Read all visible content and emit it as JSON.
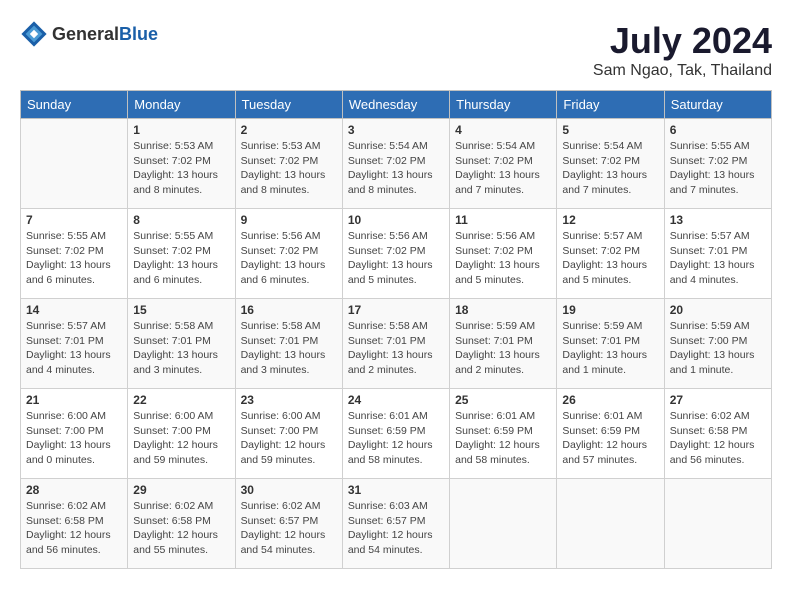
{
  "logo": {
    "text_general": "General",
    "text_blue": "Blue"
  },
  "title": {
    "month": "July 2024",
    "location": "Sam Ngao, Tak, Thailand"
  },
  "weekdays": [
    "Sunday",
    "Monday",
    "Tuesday",
    "Wednesday",
    "Thursday",
    "Friday",
    "Saturday"
  ],
  "weeks": [
    [
      {
        "day": "",
        "sunrise": "",
        "sunset": "",
        "daylight": ""
      },
      {
        "day": "1",
        "sunrise": "Sunrise: 5:53 AM",
        "sunset": "Sunset: 7:02 PM",
        "daylight": "Daylight: 13 hours and 8 minutes."
      },
      {
        "day": "2",
        "sunrise": "Sunrise: 5:53 AM",
        "sunset": "Sunset: 7:02 PM",
        "daylight": "Daylight: 13 hours and 8 minutes."
      },
      {
        "day": "3",
        "sunrise": "Sunrise: 5:54 AM",
        "sunset": "Sunset: 7:02 PM",
        "daylight": "Daylight: 13 hours and 8 minutes."
      },
      {
        "day": "4",
        "sunrise": "Sunrise: 5:54 AM",
        "sunset": "Sunset: 7:02 PM",
        "daylight": "Daylight: 13 hours and 7 minutes."
      },
      {
        "day": "5",
        "sunrise": "Sunrise: 5:54 AM",
        "sunset": "Sunset: 7:02 PM",
        "daylight": "Daylight: 13 hours and 7 minutes."
      },
      {
        "day": "6",
        "sunrise": "Sunrise: 5:55 AM",
        "sunset": "Sunset: 7:02 PM",
        "daylight": "Daylight: 13 hours and 7 minutes."
      }
    ],
    [
      {
        "day": "7",
        "sunrise": "Sunrise: 5:55 AM",
        "sunset": "Sunset: 7:02 PM",
        "daylight": "Daylight: 13 hours and 6 minutes."
      },
      {
        "day": "8",
        "sunrise": "Sunrise: 5:55 AM",
        "sunset": "Sunset: 7:02 PM",
        "daylight": "Daylight: 13 hours and 6 minutes."
      },
      {
        "day": "9",
        "sunrise": "Sunrise: 5:56 AM",
        "sunset": "Sunset: 7:02 PM",
        "daylight": "Daylight: 13 hours and 6 minutes."
      },
      {
        "day": "10",
        "sunrise": "Sunrise: 5:56 AM",
        "sunset": "Sunset: 7:02 PM",
        "daylight": "Daylight: 13 hours and 5 minutes."
      },
      {
        "day": "11",
        "sunrise": "Sunrise: 5:56 AM",
        "sunset": "Sunset: 7:02 PM",
        "daylight": "Daylight: 13 hours and 5 minutes."
      },
      {
        "day": "12",
        "sunrise": "Sunrise: 5:57 AM",
        "sunset": "Sunset: 7:02 PM",
        "daylight": "Daylight: 13 hours and 5 minutes."
      },
      {
        "day": "13",
        "sunrise": "Sunrise: 5:57 AM",
        "sunset": "Sunset: 7:01 PM",
        "daylight": "Daylight: 13 hours and 4 minutes."
      }
    ],
    [
      {
        "day": "14",
        "sunrise": "Sunrise: 5:57 AM",
        "sunset": "Sunset: 7:01 PM",
        "daylight": "Daylight: 13 hours and 4 minutes."
      },
      {
        "day": "15",
        "sunrise": "Sunrise: 5:58 AM",
        "sunset": "Sunset: 7:01 PM",
        "daylight": "Daylight: 13 hours and 3 minutes."
      },
      {
        "day": "16",
        "sunrise": "Sunrise: 5:58 AM",
        "sunset": "Sunset: 7:01 PM",
        "daylight": "Daylight: 13 hours and 3 minutes."
      },
      {
        "day": "17",
        "sunrise": "Sunrise: 5:58 AM",
        "sunset": "Sunset: 7:01 PM",
        "daylight": "Daylight: 13 hours and 2 minutes."
      },
      {
        "day": "18",
        "sunrise": "Sunrise: 5:59 AM",
        "sunset": "Sunset: 7:01 PM",
        "daylight": "Daylight: 13 hours and 2 minutes."
      },
      {
        "day": "19",
        "sunrise": "Sunrise: 5:59 AM",
        "sunset": "Sunset: 7:01 PM",
        "daylight": "Daylight: 13 hours and 1 minute."
      },
      {
        "day": "20",
        "sunrise": "Sunrise: 5:59 AM",
        "sunset": "Sunset: 7:00 PM",
        "daylight": "Daylight: 13 hours and 1 minute."
      }
    ],
    [
      {
        "day": "21",
        "sunrise": "Sunrise: 6:00 AM",
        "sunset": "Sunset: 7:00 PM",
        "daylight": "Daylight: 13 hours and 0 minutes."
      },
      {
        "day": "22",
        "sunrise": "Sunrise: 6:00 AM",
        "sunset": "Sunset: 7:00 PM",
        "daylight": "Daylight: 12 hours and 59 minutes."
      },
      {
        "day": "23",
        "sunrise": "Sunrise: 6:00 AM",
        "sunset": "Sunset: 7:00 PM",
        "daylight": "Daylight: 12 hours and 59 minutes."
      },
      {
        "day": "24",
        "sunrise": "Sunrise: 6:01 AM",
        "sunset": "Sunset: 6:59 PM",
        "daylight": "Daylight: 12 hours and 58 minutes."
      },
      {
        "day": "25",
        "sunrise": "Sunrise: 6:01 AM",
        "sunset": "Sunset: 6:59 PM",
        "daylight": "Daylight: 12 hours and 58 minutes."
      },
      {
        "day": "26",
        "sunrise": "Sunrise: 6:01 AM",
        "sunset": "Sunset: 6:59 PM",
        "daylight": "Daylight: 12 hours and 57 minutes."
      },
      {
        "day": "27",
        "sunrise": "Sunrise: 6:02 AM",
        "sunset": "Sunset: 6:58 PM",
        "daylight": "Daylight: 12 hours and 56 minutes."
      }
    ],
    [
      {
        "day": "28",
        "sunrise": "Sunrise: 6:02 AM",
        "sunset": "Sunset: 6:58 PM",
        "daylight": "Daylight: 12 hours and 56 minutes."
      },
      {
        "day": "29",
        "sunrise": "Sunrise: 6:02 AM",
        "sunset": "Sunset: 6:58 PM",
        "daylight": "Daylight: 12 hours and 55 minutes."
      },
      {
        "day": "30",
        "sunrise": "Sunrise: 6:02 AM",
        "sunset": "Sunset: 6:57 PM",
        "daylight": "Daylight: 12 hours and 54 minutes."
      },
      {
        "day": "31",
        "sunrise": "Sunrise: 6:03 AM",
        "sunset": "Sunset: 6:57 PM",
        "daylight": "Daylight: 12 hours and 54 minutes."
      },
      {
        "day": "",
        "sunrise": "",
        "sunset": "",
        "daylight": ""
      },
      {
        "day": "",
        "sunrise": "",
        "sunset": "",
        "daylight": ""
      },
      {
        "day": "",
        "sunrise": "",
        "sunset": "",
        "daylight": ""
      }
    ]
  ]
}
